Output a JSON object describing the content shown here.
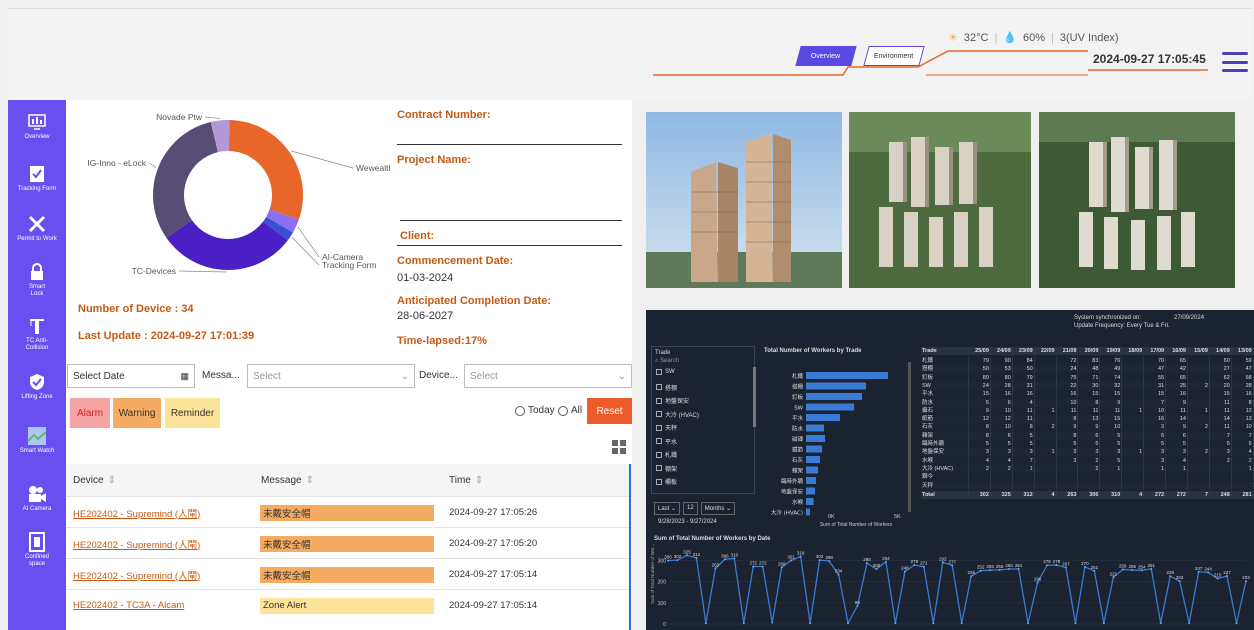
{
  "header": {
    "weather": {
      "temp": "32°C",
      "humidity": "60%",
      "uv": "3(UV Index)"
    },
    "tabs": [
      {
        "label": "Overview"
      },
      {
        "label": "Environment"
      }
    ],
    "datetime": "2024-09-27 17:05:45"
  },
  "sidebar": {
    "items": [
      {
        "label": "Overview",
        "icon": "overview-icon"
      },
      {
        "label": "Tracking Form",
        "icon": "form-icon"
      },
      {
        "label": "Permit to Work",
        "icon": "tools-icon"
      },
      {
        "label": "Smart Lock",
        "icon": "lock-icon"
      },
      {
        "label": "TC Anti-Collision",
        "icon": "crane-icon"
      },
      {
        "label": "Lifting Zone",
        "icon": "shield-icon"
      },
      {
        "label": "Smart Watch",
        "icon": "watch-icon"
      },
      {
        "label": "AI Camera",
        "icon": "camera-icon"
      },
      {
        "label": "Confined space",
        "icon": "door-icon"
      }
    ]
  },
  "donut": {
    "segments": [
      {
        "label": "Wewealth",
        "value": 0.3,
        "color": "#e8662a"
      },
      {
        "label": "AI-Camera",
        "value": 0.03,
        "color": "#8a6ff5"
      },
      {
        "label": "Tracking Form",
        "value": 0.02,
        "color": "#3a4fd0"
      },
      {
        "label": "TC-Devices",
        "value": 0.3,
        "color": "#4a1fc4"
      },
      {
        "label": "IG-Inno - eLock",
        "value": 0.31,
        "color": "#574d74"
      },
      {
        "label": "Novade Ptw",
        "value": 0.04,
        "color": "#b39ad7"
      }
    ],
    "device_count": "Number of Device : 34",
    "last_update": "Last Update : 2024-09-27 17:01:39"
  },
  "contract": {
    "contract_number_label": "Contract Number:",
    "project_name_label": "Project Name:",
    "client_label": "Client:",
    "commencement_label": "Commencement Date:",
    "commencement_value": "01-03-2024",
    "completion_label": "Anticipated Completion Date:",
    "completion_value": "28-06-2027",
    "time_lapsed_label": "Time-lapsed:",
    "time_lapsed_value": "17%"
  },
  "filters": {
    "date_placeholder": "Select Date",
    "message_label": "Messa...",
    "message_placeholder": "Select",
    "device_label": "Device...",
    "device_placeholder": "Select",
    "chips": [
      {
        "label": "Alarm",
        "color": "#f5a3a3"
      },
      {
        "label": "Warning",
        "color": "#f5ac62"
      },
      {
        "label": "Reminder",
        "color": "#fbe39a"
      }
    ],
    "radio_today": "Today",
    "radio_all": "All",
    "reset_label": "Reset"
  },
  "table": {
    "columns": [
      "Device",
      "Message",
      "Time"
    ],
    "rows": [
      {
        "device": "HE202402 - Supremind (人閘)",
        "message": "未戴安全帽",
        "time": "2024-09-27 17:05:26",
        "color": "#f5ac62"
      },
      {
        "device": "HE202402 - Supremind (人閘)",
        "message": "未戴安全帽",
        "time": "2024-09-27 17:05:20",
        "color": "#f5ac62"
      },
      {
        "device": "HE202402 - Supremind (人閘)",
        "message": "未戴安全帽",
        "time": "2024-09-27 17:05:14",
        "color": "#f5ac62"
      },
      {
        "device": "HE202402 - TC3A - Alcam",
        "message": "Zone Alert",
        "time": "2024-09-27 17:05:14",
        "color": "#fbe39a"
      }
    ]
  },
  "pbi": {
    "sync_label": "System synchronized on:",
    "sync_date": "27/09/2024",
    "update_freq": "Update Frequency: Every Tue & Fri.",
    "trade_title": "Trade",
    "search_label": "Search",
    "trades": [
      "SW",
      "搭棚",
      "地盤保安",
      "大冷 (HVAC)",
      "天秤",
      "平水",
      "札鐵",
      "棚架",
      "欄板"
    ],
    "period_last": "Last",
    "period_n": "12",
    "period_unit": "Months",
    "period_range": "9/28/2023 - 9/27/2024",
    "bar_title": "Total Number of Workers by Trade",
    "bar_categories": [
      "札鐵",
      "搭棚",
      "釘板",
      "SW",
      "平水",
      "防水",
      "磁磚",
      "鐵筋",
      "石灰",
      "雜架",
      "臨時外牆",
      "地盤保安",
      "水喉",
      "大冷 (HVAC)"
    ],
    "bar_values": [
      4100,
      3000,
      2800,
      2400,
      1700,
      900,
      950,
      800,
      700,
      600,
      500,
      450,
      380,
      200
    ],
    "bar_axis": [
      "0K",
      "5K"
    ],
    "bar_xlabel": "Sum of Total Number of Workers",
    "matrix_cols": [
      "Trade",
      "25/09",
      "24/09",
      "23/09",
      "22/09",
      "21/09",
      "20/09",
      "19/09",
      "18/09",
      "17/09",
      "16/09",
      "15/09",
      "14/09",
      "13/09"
    ],
    "matrix_rows": [
      [
        "札鐵",
        "79",
        "90",
        "84",
        "",
        "72",
        "83",
        "76",
        "",
        "70",
        "65",
        "",
        "60",
        "59"
      ],
      [
        "搭棚",
        "50",
        "53",
        "50",
        "",
        "24",
        "48",
        "49",
        "",
        "47",
        "42",
        "",
        "27",
        "47"
      ],
      [
        "釘板",
        "80",
        "80",
        "79",
        "",
        "75",
        "71",
        "74",
        "",
        "55",
        "65",
        "",
        "62",
        "68"
      ],
      [
        "SW",
        "24",
        "28",
        "31",
        "",
        "22",
        "30",
        "32",
        "",
        "31",
        "25",
        "2",
        "20",
        "28"
      ],
      [
        "平水",
        "15",
        "16",
        "16",
        "",
        "16",
        "15",
        "15",
        "",
        "15",
        "16",
        "",
        "15",
        "16"
      ],
      [
        "防水",
        "5",
        "6",
        "4",
        "",
        "10",
        "8",
        "9",
        "",
        "7",
        "9",
        "",
        "11",
        "8"
      ],
      [
        "攝石",
        "9",
        "10",
        "11",
        "1",
        "11",
        "11",
        "11",
        "1",
        "10",
        "11",
        "1",
        "11",
        "12"
      ],
      [
        "紙筋",
        "12",
        "12",
        "11",
        "",
        "8",
        "13",
        "15",
        "",
        "16",
        "14",
        "",
        "14",
        "13"
      ],
      [
        "石灰",
        "8",
        "10",
        "8",
        "2",
        "9",
        "9",
        "10",
        "",
        "3",
        "9",
        "2",
        "11",
        "10"
      ],
      [
        "雜架",
        "8",
        "6",
        "5",
        "",
        "8",
        "6",
        "5",
        "",
        "6",
        "6",
        "",
        "7",
        "7"
      ],
      [
        "臨時外牆",
        "5",
        "5",
        "5",
        "",
        "5",
        "5",
        "5",
        "",
        "5",
        "5",
        "",
        "5",
        "6"
      ],
      [
        "地盤保安",
        "3",
        "3",
        "3",
        "1",
        "3",
        "3",
        "3",
        "1",
        "3",
        "3",
        "2",
        "3",
        "4"
      ],
      [
        "水喉",
        "4",
        "4",
        "7",
        "",
        "3",
        "2",
        "5",
        "",
        "3",
        "4",
        "",
        "2",
        "2"
      ],
      [
        "大冷 (HVAC)",
        "2",
        "2",
        "1",
        "",
        "",
        "2",
        "1",
        "",
        "1",
        "1",
        "",
        "",
        "1"
      ],
      [
        "鋼今",
        "",
        "",
        "",
        "",
        "",
        "",
        "",
        "",
        "",
        "",
        "",
        "",
        ""
      ],
      [
        "天秤",
        "",
        "",
        "",
        "",
        "",
        "",
        "",
        "",
        "",
        "",
        "",
        "",
        ""
      ]
    ],
    "matrix_total": [
      "Total",
      "302",
      "325",
      "312",
      "4",
      "263",
      "306",
      "310",
      "4",
      "272",
      "272",
      "7",
      "248",
      "281"
    ],
    "line_title": "Sum of Total Number of Workers by Date",
    "line_ylabel": "Sum of Total Number of Wor...",
    "line_yticks": [
      "0",
      "100",
      "200",
      "300"
    ]
  },
  "chart_data": {
    "type": "line",
    "title": "Sum of Total Number of Workers by Date",
    "ylabel": "Sum of Total Number of Wor...",
    "ylim": [
      0,
      350
    ],
    "series": [
      {
        "values": [
          300,
          302,
          325,
          312,
          4,
          263,
          306,
          310,
          4,
          272,
          272,
          7,
          268,
          301,
          319,
          4,
          302,
          298,
          234,
          4,
          86,
          288,
          260,
          294,
          4,
          248,
          279,
          271,
          4,
          292,
          277,
          4,
          226,
          252,
          255,
          256,
          260,
          261,
          4,
          196,
          278,
          279,
          267,
          4,
          270,
          251,
          4,
          221,
          258,
          255,
          254,
          261,
          4,
          226,
          203,
          4,
          247,
          244,
          215,
          227,
          4,
          203
        ]
      }
    ]
  }
}
